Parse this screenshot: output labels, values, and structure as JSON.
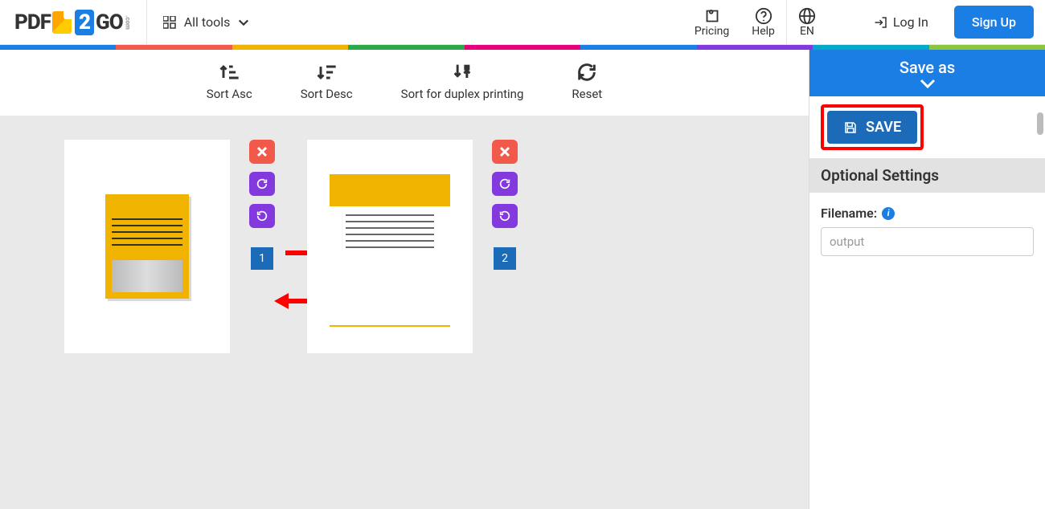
{
  "brand": {
    "p1": "PDF",
    "p2": "2",
    "p3": "GO",
    "com": ".com"
  },
  "header": {
    "all_tools": "All tools",
    "pricing": "Pricing",
    "help": "Help",
    "lang": "EN",
    "login": "Log In",
    "signup": "Sign Up"
  },
  "rainbow_colors": [
    "#1b7ee4",
    "#f1594a",
    "#f0b400",
    "#2aa84a",
    "#e6007e",
    "#1b7ee4",
    "#8339dd",
    "#00a9c7",
    "#8cc63f"
  ],
  "toolbar": {
    "sort_asc": "Sort Asc",
    "sort_desc": "Sort Desc",
    "duplex": "Sort for duplex printing",
    "reset": "Reset"
  },
  "pages": [
    {
      "number": "1"
    },
    {
      "number": "2"
    }
  ],
  "panel": {
    "save_as": "Save as",
    "save": "SAVE",
    "optional": "Optional Settings",
    "filename_label": "Filename:",
    "filename_placeholder": "output"
  }
}
